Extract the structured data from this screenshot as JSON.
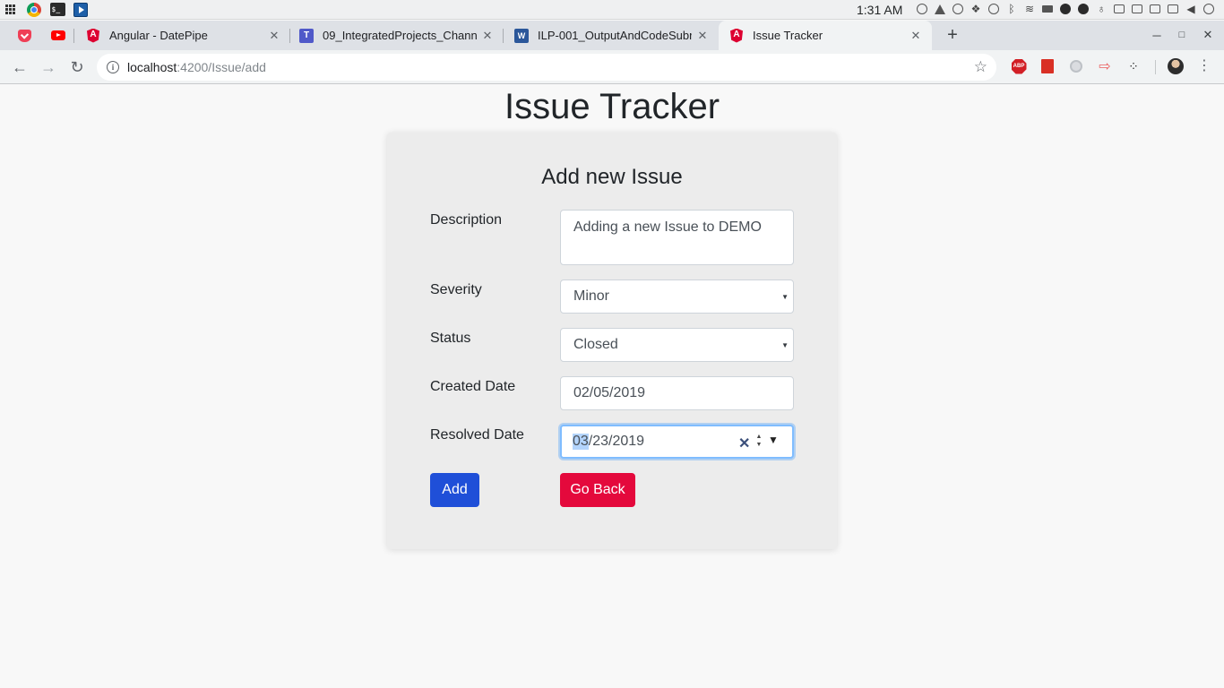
{
  "os": {
    "clock": "1:31 AM",
    "tray_icons": [
      "info-circle-icon",
      "vlc-icon",
      "pause-icon",
      "dropbox-icon",
      "clock-icon",
      "bluetooth-icon",
      "wifi-icon",
      "battery-icon",
      "circle-icon",
      "download-icon",
      "bulb-icon",
      "clipboard-icon",
      "usb-icon",
      "keyboard-icon",
      "sdcard-icon",
      "volume-icon",
      "power-icon"
    ]
  },
  "tabs": [
    {
      "pinned": true,
      "icon": "pocket-icon"
    },
    {
      "pinned": true,
      "icon": "youtube-icon"
    },
    {
      "title": "Angular - DatePipe",
      "icon": "angular-icon"
    },
    {
      "title": "09_IntegratedProjects_Chann",
      "icon": "teams-icon"
    },
    {
      "title": "ILP-001_OutputAndCodeSubr",
      "icon": "word-icon"
    },
    {
      "title": "Issue Tracker",
      "icon": "angular-icon",
      "active": true
    }
  ],
  "address": {
    "host": "localhost",
    "path": ":4200/Issue/add"
  },
  "page": {
    "title": "Issue Tracker",
    "card_title": "Add new Issue"
  },
  "form": {
    "description": {
      "label": "Description",
      "value": "Adding a new Issue to DEMO"
    },
    "severity": {
      "label": "Severity",
      "value": "Minor"
    },
    "status": {
      "label": "Status",
      "value": "Closed"
    },
    "created_date": {
      "label": "Created Date",
      "value": "02/05/2019"
    },
    "resolved_date": {
      "label": "Resolved Date",
      "month": "03",
      "rest": "/23/2019"
    },
    "add_button": "Add",
    "back_button": "Go Back"
  },
  "colors": {
    "add_button": "#1f4fd8",
    "back_button": "#e4093c",
    "focus_border": "#80bdff"
  }
}
